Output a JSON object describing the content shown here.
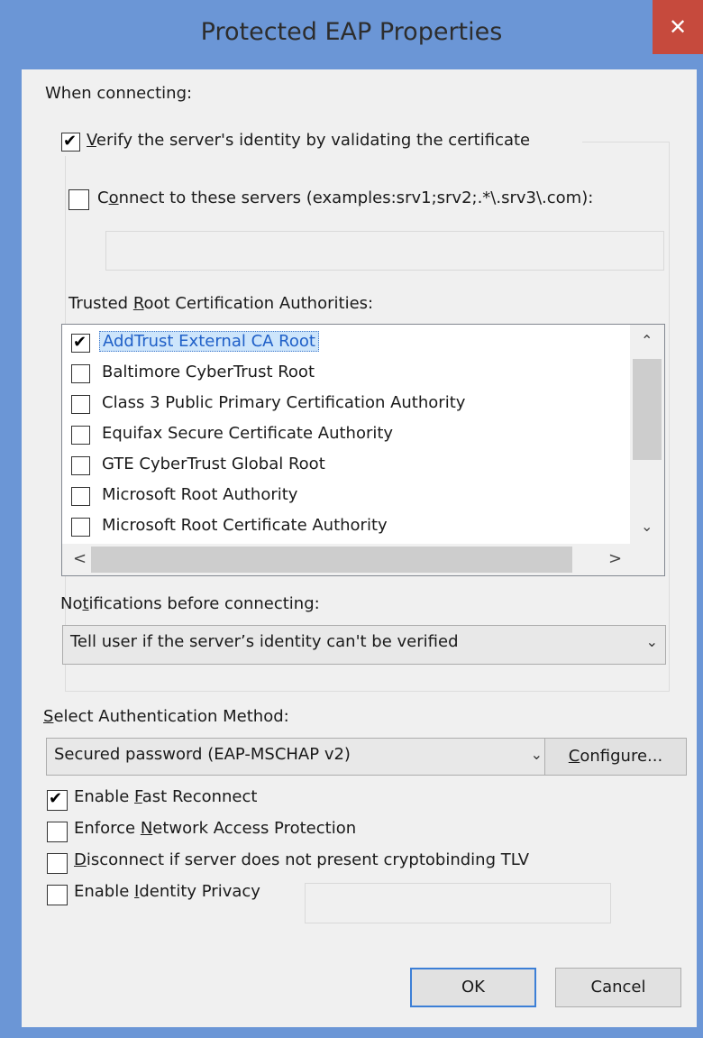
{
  "dialog": {
    "title": "Protected EAP Properties",
    "close_glyph": "✕"
  },
  "connecting": {
    "heading": "When connecting:",
    "verify_label": {
      "pre": "",
      "u": "V",
      "post": "erify the server's identity by validating the certificate"
    },
    "verify_checked": true,
    "connect_servers_label": {
      "pre": "C",
      "u": "o",
      "post": "nnect to these servers (examples:srv1;srv2;.*\\.srv3\\.com):"
    },
    "connect_servers_checked": false,
    "servers_value": "",
    "trusted_label": {
      "pre": "Trusted ",
      "u": "R",
      "post": "oot Certification Authorities:"
    },
    "authorities": [
      {
        "name": "AddTrust External CA Root",
        "checked": true,
        "selected": true
      },
      {
        "name": "Baltimore CyberTrust Root",
        "checked": false,
        "selected": false
      },
      {
        "name": "Class 3 Public Primary Certification Authority",
        "checked": false,
        "selected": false
      },
      {
        "name": "Equifax Secure Certificate Authority",
        "checked": false,
        "selected": false
      },
      {
        "name": "GTE CyberTrust Global Root",
        "checked": false,
        "selected": false
      },
      {
        "name": "Microsoft Root Authority",
        "checked": false,
        "selected": false
      },
      {
        "name": "Microsoft Root Certificate Authority",
        "checked": false,
        "selected": false
      }
    ],
    "notifications_label": {
      "pre": "No",
      "u": "t",
      "post": "ifications before connecting:"
    },
    "notifications_value": "Tell user if the server’s identity can't be verified"
  },
  "auth": {
    "label": {
      "pre": "",
      "u": "S",
      "post": "elect Authentication Method:"
    },
    "method_value": "Secured password (EAP-MSCHAP v2)",
    "configure_label": {
      "pre": "",
      "u": "C",
      "post": "onfigure..."
    }
  },
  "options": [
    {
      "pre": "Enable ",
      "u": "F",
      "post": "ast Reconnect",
      "checked": true
    },
    {
      "pre": "Enforce ",
      "u": "N",
      "post": "etwork Access Protection",
      "checked": false
    },
    {
      "pre": "",
      "u": "D",
      "post": "isconnect if server does not present cryptobinding TLV",
      "checked": false
    },
    {
      "pre": "Enable ",
      "u": "I",
      "post": "dentity Privacy",
      "checked": false
    }
  ],
  "identity_value": "",
  "buttons": {
    "ok": "OK",
    "cancel": "Cancel"
  },
  "icons": {
    "scroll_up": "⌃",
    "scroll_down": "⌄",
    "scroll_left": "<",
    "scroll_right": ">",
    "dropdown": "⌄"
  }
}
